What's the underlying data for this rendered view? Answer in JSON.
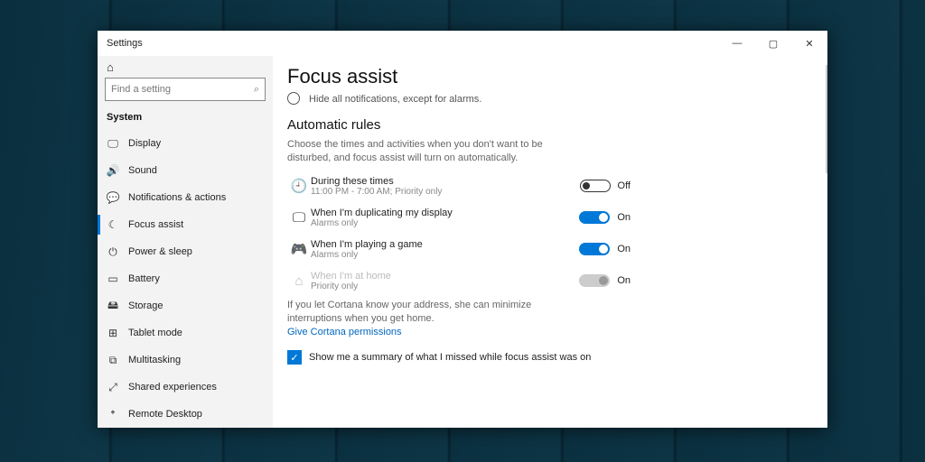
{
  "app_title": "Settings",
  "window_buttons": {
    "min": "—",
    "max": "▢",
    "close": "✕"
  },
  "home_icon": "⌂",
  "search": {
    "placeholder": "Find a setting",
    "icon": "🔍"
  },
  "section_label": "System",
  "sidebar_items": [
    {
      "icon": "🖵",
      "label": "Display",
      "active": false
    },
    {
      "icon": "🔊",
      "label": "Sound",
      "active": false
    },
    {
      "icon": "💬",
      "label": "Notifications & actions",
      "active": false
    },
    {
      "icon": "☾",
      "label": "Focus assist",
      "active": true
    },
    {
      "icon": "⏻",
      "label": "Power & sleep",
      "active": false
    },
    {
      "icon": "▭",
      "label": "Battery",
      "active": false
    },
    {
      "icon": "🖴",
      "label": "Storage",
      "active": false
    },
    {
      "icon": "⊞",
      "label": "Tablet mode",
      "active": false
    },
    {
      "icon": "⧉",
      "label": "Multitasking",
      "active": false
    },
    {
      "icon": "⤢",
      "label": "Shared experiences",
      "active": false
    },
    {
      "icon": "𝄌",
      "label": "Remote Desktop",
      "active": false
    }
  ],
  "page": {
    "title": "Focus assist",
    "radio_sub": "Hide all notifications, except for alarms.",
    "rules_title": "Automatic rules",
    "rules_desc": "Choose the times and activities when you don't want to be disturbed, and focus assist will turn on automatically.",
    "rules": [
      {
        "icon": "🕘",
        "title": "During these times",
        "sub": "11:00 PM - 7:00 AM; Priority only",
        "state": "off",
        "state_label": "Off",
        "disabled": false
      },
      {
        "icon": "🖵",
        "title": "When I'm duplicating my display",
        "sub": "Alarms only",
        "state": "on",
        "state_label": "On",
        "disabled": false
      },
      {
        "icon": "🎮",
        "title": "When I'm playing a game",
        "sub": "Alarms only",
        "state": "on",
        "state_label": "On",
        "disabled": false
      },
      {
        "icon": "⌂",
        "title": "When I'm at home",
        "sub": "Priority only",
        "state": "disabled",
        "state_label": "On",
        "disabled": true
      }
    ],
    "cortana_text": "If you let Cortana know your address, she can minimize interruptions when you get home.",
    "cortana_link": "Give Cortana permissions",
    "summary_checkbox": {
      "checked": true,
      "label": "Show me a summary of what I missed while focus assist was on"
    }
  }
}
